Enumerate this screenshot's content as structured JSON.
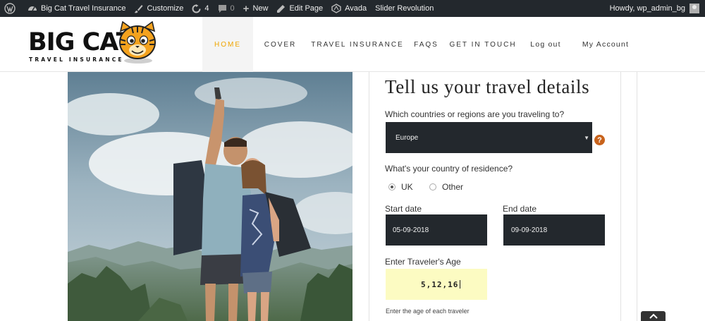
{
  "admin_bar": {
    "site_name": "Big Cat Travel Insurance",
    "customize": "Customize",
    "updates_count": "4",
    "comments_count": "0",
    "new_label": "New",
    "edit_page": "Edit Page",
    "avada": "Avada",
    "slider_revolution": "Slider Revolution",
    "howdy": "Howdy, wp_admin_bg"
  },
  "logo": {
    "title": "BIG CAT",
    "subtitle": "TRAVEL INSURANCE"
  },
  "nav": {
    "items": [
      {
        "label": "HOME",
        "active": true
      },
      {
        "label": "COVER"
      },
      {
        "label": "TRAVEL INSURANCE"
      },
      {
        "label": "FAQS"
      },
      {
        "label": "GET IN TOUCH"
      },
      {
        "label": "Log out"
      },
      {
        "label": "My Account"
      }
    ]
  },
  "form": {
    "title": "Tell us your travel details",
    "countries_label": "Which countries or regions are you traveling to?",
    "countries_value": "Europe",
    "help_icon": "?",
    "residence_label": "What's your country of residence?",
    "residence_options": [
      "UK",
      "Other"
    ],
    "residence_selected": "UK",
    "start_date_label": "Start date",
    "start_date_value": "05-09-2018",
    "end_date_label": "End date",
    "end_date_value": "09-09-2018",
    "age_label": "Enter Traveler's Age",
    "age_value": "5,12,16",
    "age_hint": "Enter the age of each traveler"
  },
  "colors": {
    "admin_bar_bg": "#23282d",
    "nav_active": "#f0a500",
    "field_dark": "#23282d",
    "help_icon": "#c8631c",
    "age_field_bg": "#fcfbc2"
  }
}
